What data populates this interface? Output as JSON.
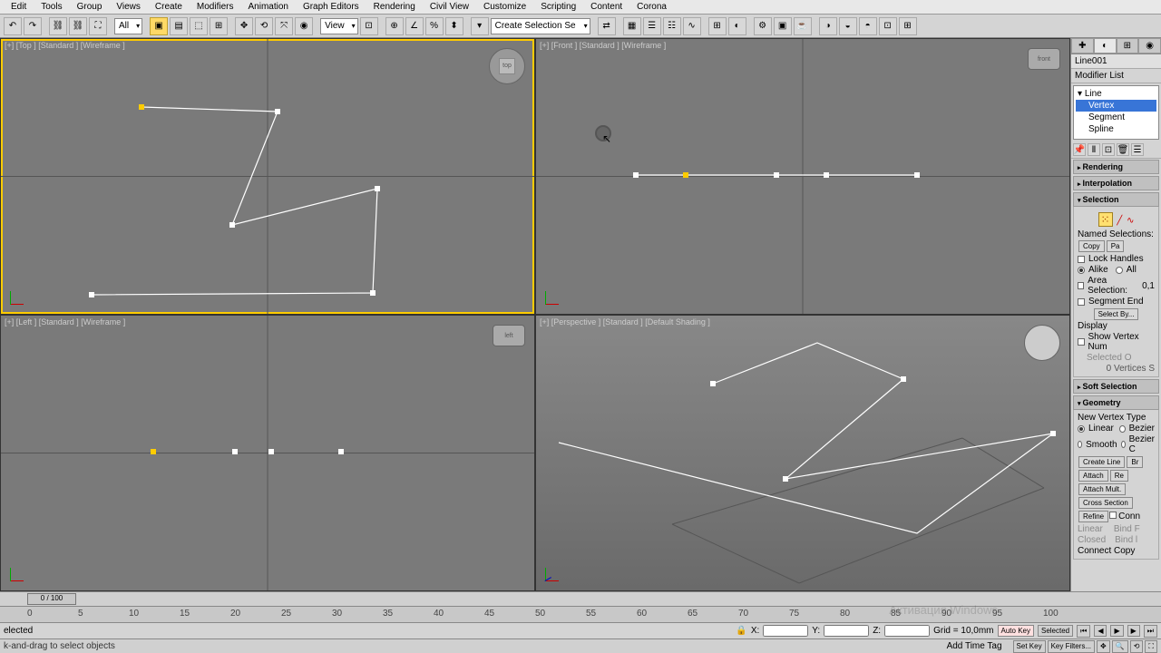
{
  "menu": [
    "Edit",
    "Tools",
    "Group",
    "Views",
    "Create",
    "Modifiers",
    "Animation",
    "Graph Editors",
    "Rendering",
    "Civil View",
    "Customize",
    "Scripting",
    "Content",
    "Corona"
  ],
  "toolbar": {
    "dd_all": "All",
    "dd_view": "View",
    "dd_selset": "Create Selection Se"
  },
  "vp": {
    "top": "[+] [Top ] [Standard ] [Wireframe ]",
    "front": "[+] [Front ] [Standard ] [Wireframe ]",
    "left": "[+] [Left ] [Standard ] [Wireframe ]",
    "persp": "[+] [Perspective ] [Standard ] [Default Shading ]"
  },
  "cubelabel": {
    "top": "top",
    "front": "front",
    "left": "left"
  },
  "cmd": {
    "objname": "Line001",
    "modlist": "Modifier List",
    "tree_line": "Line",
    "tree_vertex": "Vertex",
    "tree_segment": "Segment",
    "tree_spline": "Spline"
  },
  "roll": {
    "rendering": "Rendering",
    "interp": "Interpolation",
    "selection": "Selection",
    "named": "Named Selections:",
    "copy": "Copy",
    "paste": "Pa",
    "lock": "Lock Handles",
    "alike": "Alike",
    "all": "All",
    "area": "Area Selection:",
    "areaval": "0,1",
    "segend": "Segment End",
    "selectby": "Select By...",
    "display": "Display",
    "showvert": "Show Vertex Num",
    "selonly": "Selected O",
    "vcount": "0 Vertices S",
    "softsel": "Soft Selection",
    "geometry": "Geometry",
    "newvt": "New Vertex Type",
    "linear": "Linear",
    "bezier": "Bezier",
    "smooth": "Smooth",
    "bezierc": "Bezier C",
    "createline": "Create Line",
    "break": "Br",
    "attach": "Attach",
    "reorient": "Re",
    "attachmult": "Attach Mult.",
    "crosssect": "Cross Section",
    "refine": "Refine",
    "connect": "Conn",
    "linear2": "Linear",
    "bindf": "Bind F",
    "closed": "Closed",
    "bindl": "Bind l",
    "connectcopy": "Connect Copy"
  },
  "time": {
    "slider": "0 / 100"
  },
  "ticks": [
    "0",
    "5",
    "10",
    "15",
    "20",
    "25",
    "30",
    "35",
    "40",
    "45",
    "50",
    "55",
    "60",
    "65",
    "70",
    "75",
    "80",
    "85",
    "90",
    "95",
    "100"
  ],
  "status": {
    "sel": "elected",
    "x": "X:",
    "y": "Y:",
    "z": "Z:",
    "grid": "Grid = 10,0mm",
    "autokey": "Auto Key",
    "selected": "Selected",
    "addtag": "Add Time Tag",
    "setkey": "Set Key",
    "keyfilt": "Key Filters..."
  },
  "prompt": "k-and-drag to select objects",
  "watermark": "Активация Windows"
}
